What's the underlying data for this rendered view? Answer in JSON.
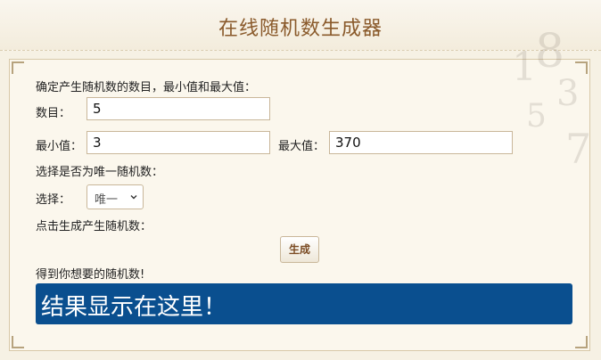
{
  "page_title": "在线随机数生成器",
  "intro_text": "确定产生随机数的数目，最小值和最大值：",
  "count": {
    "label": "数目：",
    "value": "5"
  },
  "min": {
    "label": "最小值：",
    "value": "3"
  },
  "max": {
    "label": "最大值：",
    "value": "370"
  },
  "unique_prompt": "选择是否为唯一随机数：",
  "select": {
    "label": "选择：",
    "selected": "唯一"
  },
  "generate_prompt": "点击生成产生随机数：",
  "generate_button": "生成",
  "result_caption": "得到你想要的随机数!",
  "result_text": "结果显示在这里！",
  "colors": {
    "title": "#8a5a2b",
    "result_background": "#0a4f8f",
    "page_background": "#f6f1e4"
  }
}
